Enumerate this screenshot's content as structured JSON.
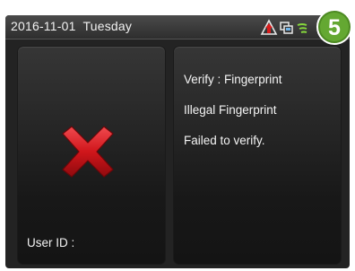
{
  "status_bar": {
    "date": "2016-11-01",
    "weekday": "Tuesday",
    "icons": [
      "alarm-warning-icon",
      "network-icon",
      "signal-icon"
    ]
  },
  "badge": {
    "number": "5",
    "color": "#5a9a2a"
  },
  "left_panel": {
    "result_icon": "red-x-icon",
    "user_id_label": "User ID :"
  },
  "right_panel": {
    "verify_line": "Verify : Fingerprint",
    "status_line": "Illegal Fingerprint",
    "result_line": "Failed to verify."
  },
  "colors": {
    "background": "#232323",
    "text": "#f4f4f4",
    "error": "#d0161b"
  }
}
